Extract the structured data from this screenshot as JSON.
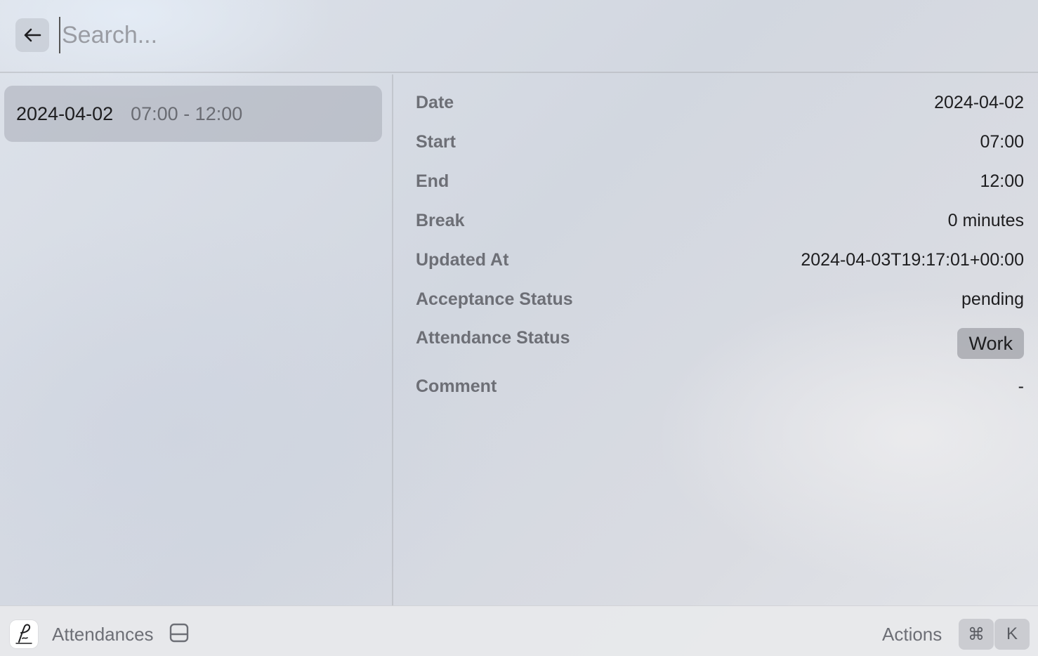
{
  "search": {
    "placeholder": "Search..."
  },
  "list": {
    "items": [
      {
        "date": "2024-04-02",
        "time": "07:00 - 12:00"
      }
    ]
  },
  "detail": {
    "date_label": "Date",
    "date_value": "2024-04-02",
    "start_label": "Start",
    "start_value": "07:00",
    "end_label": "End",
    "end_value": "12:00",
    "break_label": "Break",
    "break_value": "0 minutes",
    "updated_label": "Updated At",
    "updated_value": "2024-04-03T19:17:01+00:00",
    "acceptance_label": "Acceptance Status",
    "acceptance_value": "pending",
    "attendance_label": "Attendance Status",
    "attendance_value": "Work",
    "comment_label": "Comment",
    "comment_value": "-"
  },
  "footer": {
    "title": "Attendances",
    "actions_label": "Actions",
    "shortcut_keys": [
      "⌘",
      "K"
    ]
  },
  "icons": {
    "back": "arrow-left-icon",
    "app": "signature-icon",
    "tray": "tray-icon"
  }
}
